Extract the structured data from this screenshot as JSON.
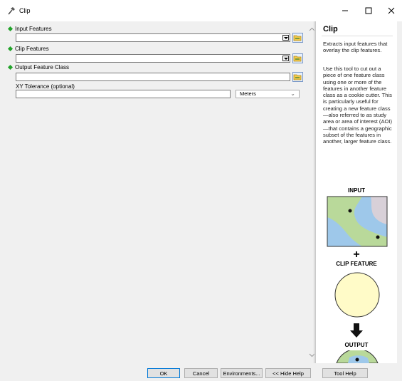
{
  "window": {
    "title": "Clip"
  },
  "params": {
    "input_features": {
      "label": "Input Features",
      "value": ""
    },
    "clip_features": {
      "label": "Clip Features",
      "value": ""
    },
    "output_feature_class": {
      "label": "Output Feature Class",
      "value": ""
    },
    "xy_tolerance": {
      "label": "XY Tolerance (optional)",
      "value": "",
      "unit": "Meters"
    }
  },
  "help": {
    "title": "Clip",
    "summary": "Extracts input features that overlay the clip features.",
    "body": "Use this tool to cut out a piece of one feature class using one or more of the features in another feature class as a cookie cutter. This is particularly useful for creating a new feature class—also referred to as study area or area of interest (AOI)—that contains a geographic subset of the features in another, larger feature class.",
    "diagram": {
      "input_label": "INPUT",
      "plus": "+",
      "clip_label": "CLIP FEATURE",
      "output_label": "OUTPUT"
    }
  },
  "buttons": {
    "ok": "OK",
    "cancel": "Cancel",
    "environments": "Environments...",
    "hide_help": "<< Hide Help",
    "tool_help": "Tool Help"
  },
  "colors": {
    "required_marker": "#22a32a",
    "default_button_border": "#0078d7"
  }
}
